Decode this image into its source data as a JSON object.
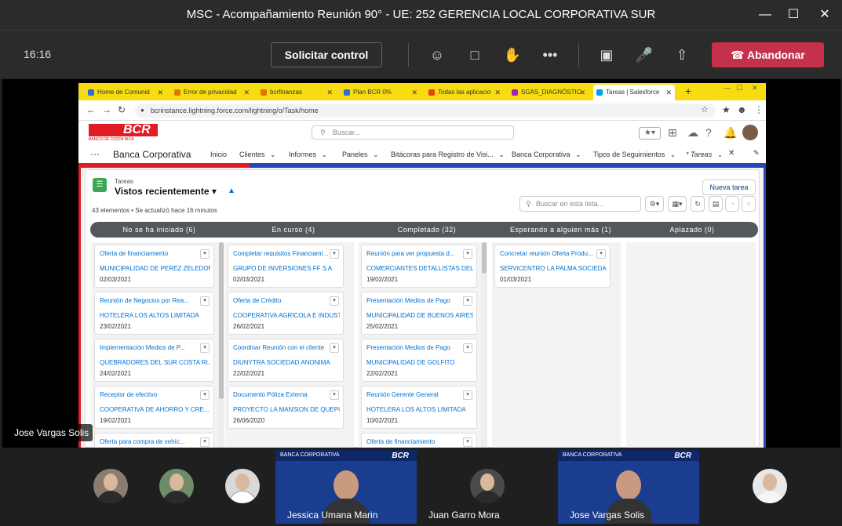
{
  "window": {
    "title": "MSC - Acompañamiento Reunión 90° - UE: 252 GERENCIA LOCAL CORPORATIVA SUR"
  },
  "toolbar": {
    "time": "16:16",
    "request_control": "Solicitar control",
    "leave": "Abandonar"
  },
  "browser": {
    "tabs": [
      {
        "label": "Home de Comunid",
        "color": "#2c6fd1"
      },
      {
        "label": "Error de privacidad",
        "color": "#e37400"
      },
      {
        "label": "bcrfinanzas",
        "color": "#e37400"
      },
      {
        "label": "Plan BCR 0%",
        "color": "#2c6fd1"
      },
      {
        "label": "Todas las aplicacio",
        "color": "#e8430f"
      },
      {
        "label": "SGAS_DIAGNÓSTIC",
        "color": "#9c27b0"
      },
      {
        "label": "Tareas | Salesforce",
        "color": "#00a1e0"
      }
    ],
    "url": "bcrinstance.lightning.force.com/lightning/o/Task/home"
  },
  "sf": {
    "logo": "BCR",
    "logo_sub": "BANCO DE COSTA RICA",
    "search_placeholder": "Buscar...",
    "app_name": "Banca Corporativa",
    "nav": [
      "Inicio",
      "Clientes",
      "Informes",
      "Paneles",
      "Bitácoras para Registro de Visi...",
      "Banca Corporativa",
      "Tipos de Seguimientos",
      "* Tareas"
    ],
    "object_label": "Tareas",
    "list_view": "Vistos recientemente",
    "meta": "43 elementos • Se actualizó hace 16 minutos",
    "new_button": "Nueva tarea",
    "list_search_placeholder": "Buscar en esta lista...",
    "stages": [
      "No se ha iniciado  (6)",
      "En curso  (4)",
      "Completado  (32)",
      "Esperando a alguien más  (1)",
      "Aplazado  (0)"
    ],
    "columns": [
      [
        {
          "title": "Oferta de financiamiento",
          "account": "MUNICIPALIDAD DE PEREZ ZELEDON",
          "date": "02/03/2021"
        },
        {
          "title": "Reunión de Negocios por Rea...",
          "account": "HOTELERA LOS ALTOS LIMITADA",
          "date": "23/02/2021"
        },
        {
          "title": "Implementación Medios de P...",
          "account": "QUEBRADORES DEL SUR COSTA RI...",
          "date": "24/02/2021"
        },
        {
          "title": "Receptor de efectivo",
          "account": "COOPERATIVA DE AHORRO Y CRE...",
          "date": "19/02/2021"
        },
        {
          "title": "Oferta para compra de vehíc...",
          "account": "",
          "date": ""
        }
      ],
      [
        {
          "title": "Completar requisitos Financiamí...",
          "account": "GRUPO DE INVERSIONES FF S A",
          "date": "02/03/2021"
        },
        {
          "title": "Oferta de Crédito",
          "account": "COOPERATIVA AGRICOLA E INDUSTRI...",
          "date": "26/02/2021"
        },
        {
          "title": "Coordinar Reunión con el cliente",
          "account": "DIUNYTRA SOCIEDAD ANONIMA",
          "date": "22/02/2021"
        },
        {
          "title": "Documento Póliza Externa",
          "account": "PROYECTO LA MANSION DE QUEPOS ...",
          "date": "26/06/2020"
        }
      ],
      [
        {
          "title": "Reunión para ver propuesta d...",
          "account": "COMERCIANTES DETALLISTAS DEL ...",
          "date": "19/02/2021"
        },
        {
          "title": "Presentación Medios de Pago",
          "account": "MUNICIPALIDAD DE BUENOS AIRES",
          "date": "25/02/2021"
        },
        {
          "title": "Presentación Medios de Pago",
          "account": "MUNICIPALIDAD DE GOLFITO",
          "date": "22/02/2021"
        },
        {
          "title": "Reunión Gerente General",
          "account": "HOTELERA LOS ALTOS LIMITADA",
          "date": "10/02/2021"
        },
        {
          "title": "Oferta de financiamiento",
          "account": "",
          "date": ""
        }
      ],
      [
        {
          "title": "Concretar reunión Oferta Produ...",
          "account": "SERVICENTRO LA PALMA SOCIEDAD A...",
          "date": "01/03/2021"
        }
      ]
    ]
  },
  "presenter_label": "Jose Vargas Solis",
  "participants": {
    "tiles": [
      "Jessica Umana Marin",
      "Juan Garro Mora",
      "Jose Vargas Solis"
    ],
    "tile_band": "BANCA CORPORATIVA",
    "tile_logo": "BCR"
  }
}
